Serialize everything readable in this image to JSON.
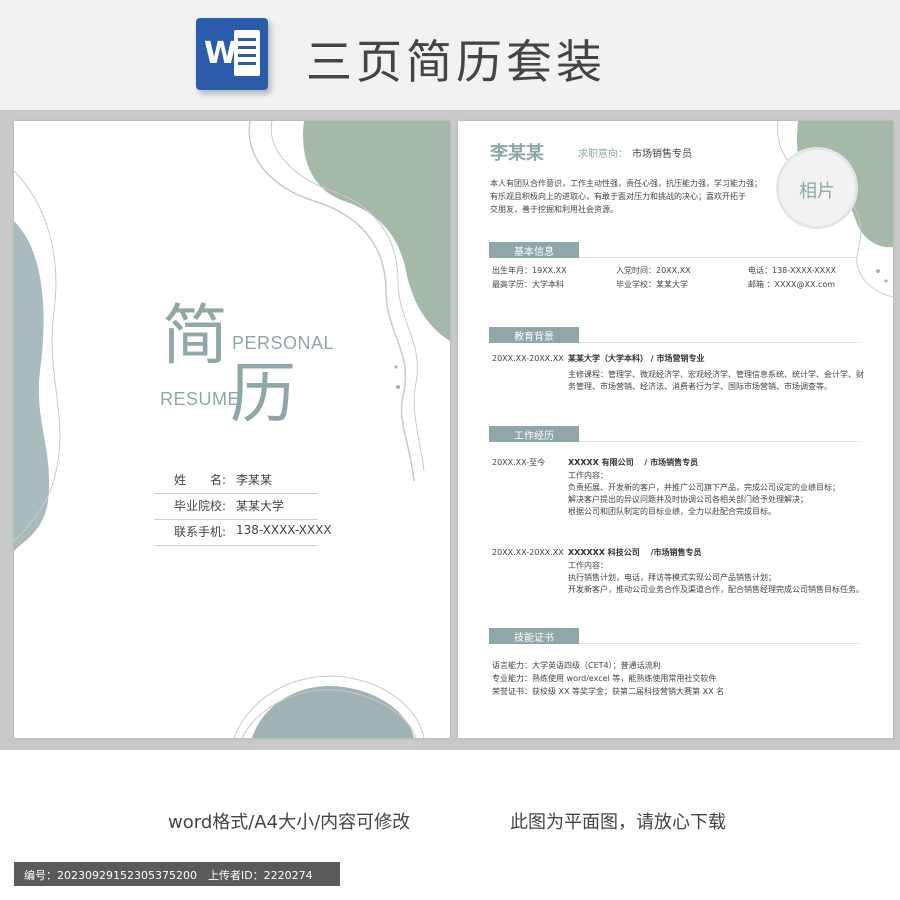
{
  "header": {
    "icon_letter": "W",
    "title": "三页简历套装"
  },
  "cover": {
    "char_1": "简",
    "char_2": "历",
    "en_1": "PERSONAL",
    "en_2": "RESUME",
    "rows": [
      {
        "label": "姓　　名:",
        "value": "李某某"
      },
      {
        "label": "毕业院校:",
        "value": "某某大学"
      },
      {
        "label": "联系手机:",
        "value": "138-XXXX-XXXX"
      }
    ]
  },
  "resume": {
    "name": "李某某",
    "intent_label": "求职意向：",
    "intent_value": "市场销售专员",
    "photo": "相片",
    "intro": [
      "本人有团队合作意识，工作主动性强，责任心强，抗压能力强，学习能力强；",
      "有乐观且积极向上的进取心，有敢于面对压力和挑战的决心；喜欢开拓于",
      "交朋友，善于挖掘和利用社会资源。"
    ],
    "basic": {
      "title": "基本信息",
      "items": [
        "出生年月：19XX.XX",
        "入党时间：20XX.XX",
        "电话：138-XXXX-XXXX",
        "最高学历：大学本科",
        "毕业学校：某某大学",
        "邮箱 ：XXXX@XX.com"
      ]
    },
    "education": {
      "title": "教育背景",
      "date": "20XX.XX-20XX.XX",
      "school": "某某大学（大学本科） / 市场营销专业",
      "courses": [
        "主修课程：管理学、微观经济学、宏观经济学、管理信息系统、统计学、会计学、财",
        "务管理、市场营销、经济法、消费者行为学、国际市场营销、市场调查等。"
      ]
    },
    "work": {
      "title": "工作经历",
      "jobs": [
        {
          "date": "20XX.XX-至今",
          "company": "XXXXX 有限公司　 /  市场销售专员",
          "label": "工作内容：",
          "lines": [
            "负责拓展、开发新的客户，并推广公司旗下产品，完成公司设定的业绩目标；",
            "解决客户提出的异议问题并及时协调公司各相关部门给予处理解决；",
            "根据公司和团队制定的目标业绩，全力以赴配合完成目标。"
          ]
        },
        {
          "date": "20XX.XX-20XX.XX",
          "company": "XXXXXX 科技公司　 /市场销售专员",
          "label": "工作内容：",
          "lines": [
            "执行销售计划，电话，拜访等模式实现公司产品销售计划；",
            "开发新客户，推动公司业务合作及渠道合作，配合销售经理完成公司销售目标任务。"
          ]
        }
      ]
    },
    "skills": {
      "title": "技能证书",
      "lines": [
        "语言能力：大学英语四级（CET4）；普通话流利",
        "专业能力：熟练使用 word/excel 等，能熟练使用常用社交软件",
        "荣誉证书：获校级 XX 等奖学金；获第二届科技营销大赛第 XX 名"
      ]
    }
  },
  "footer": {
    "left": "word格式/A4大小/内容可修改",
    "right": "此图为平面图，请放心下载",
    "id_text": "编号：20230929152305375200　上传者ID：2220274"
  },
  "colors": {
    "accent": "#8fa7a8",
    "green_shape": "#a4b9a8",
    "word_blue": "#2b5bab"
  }
}
